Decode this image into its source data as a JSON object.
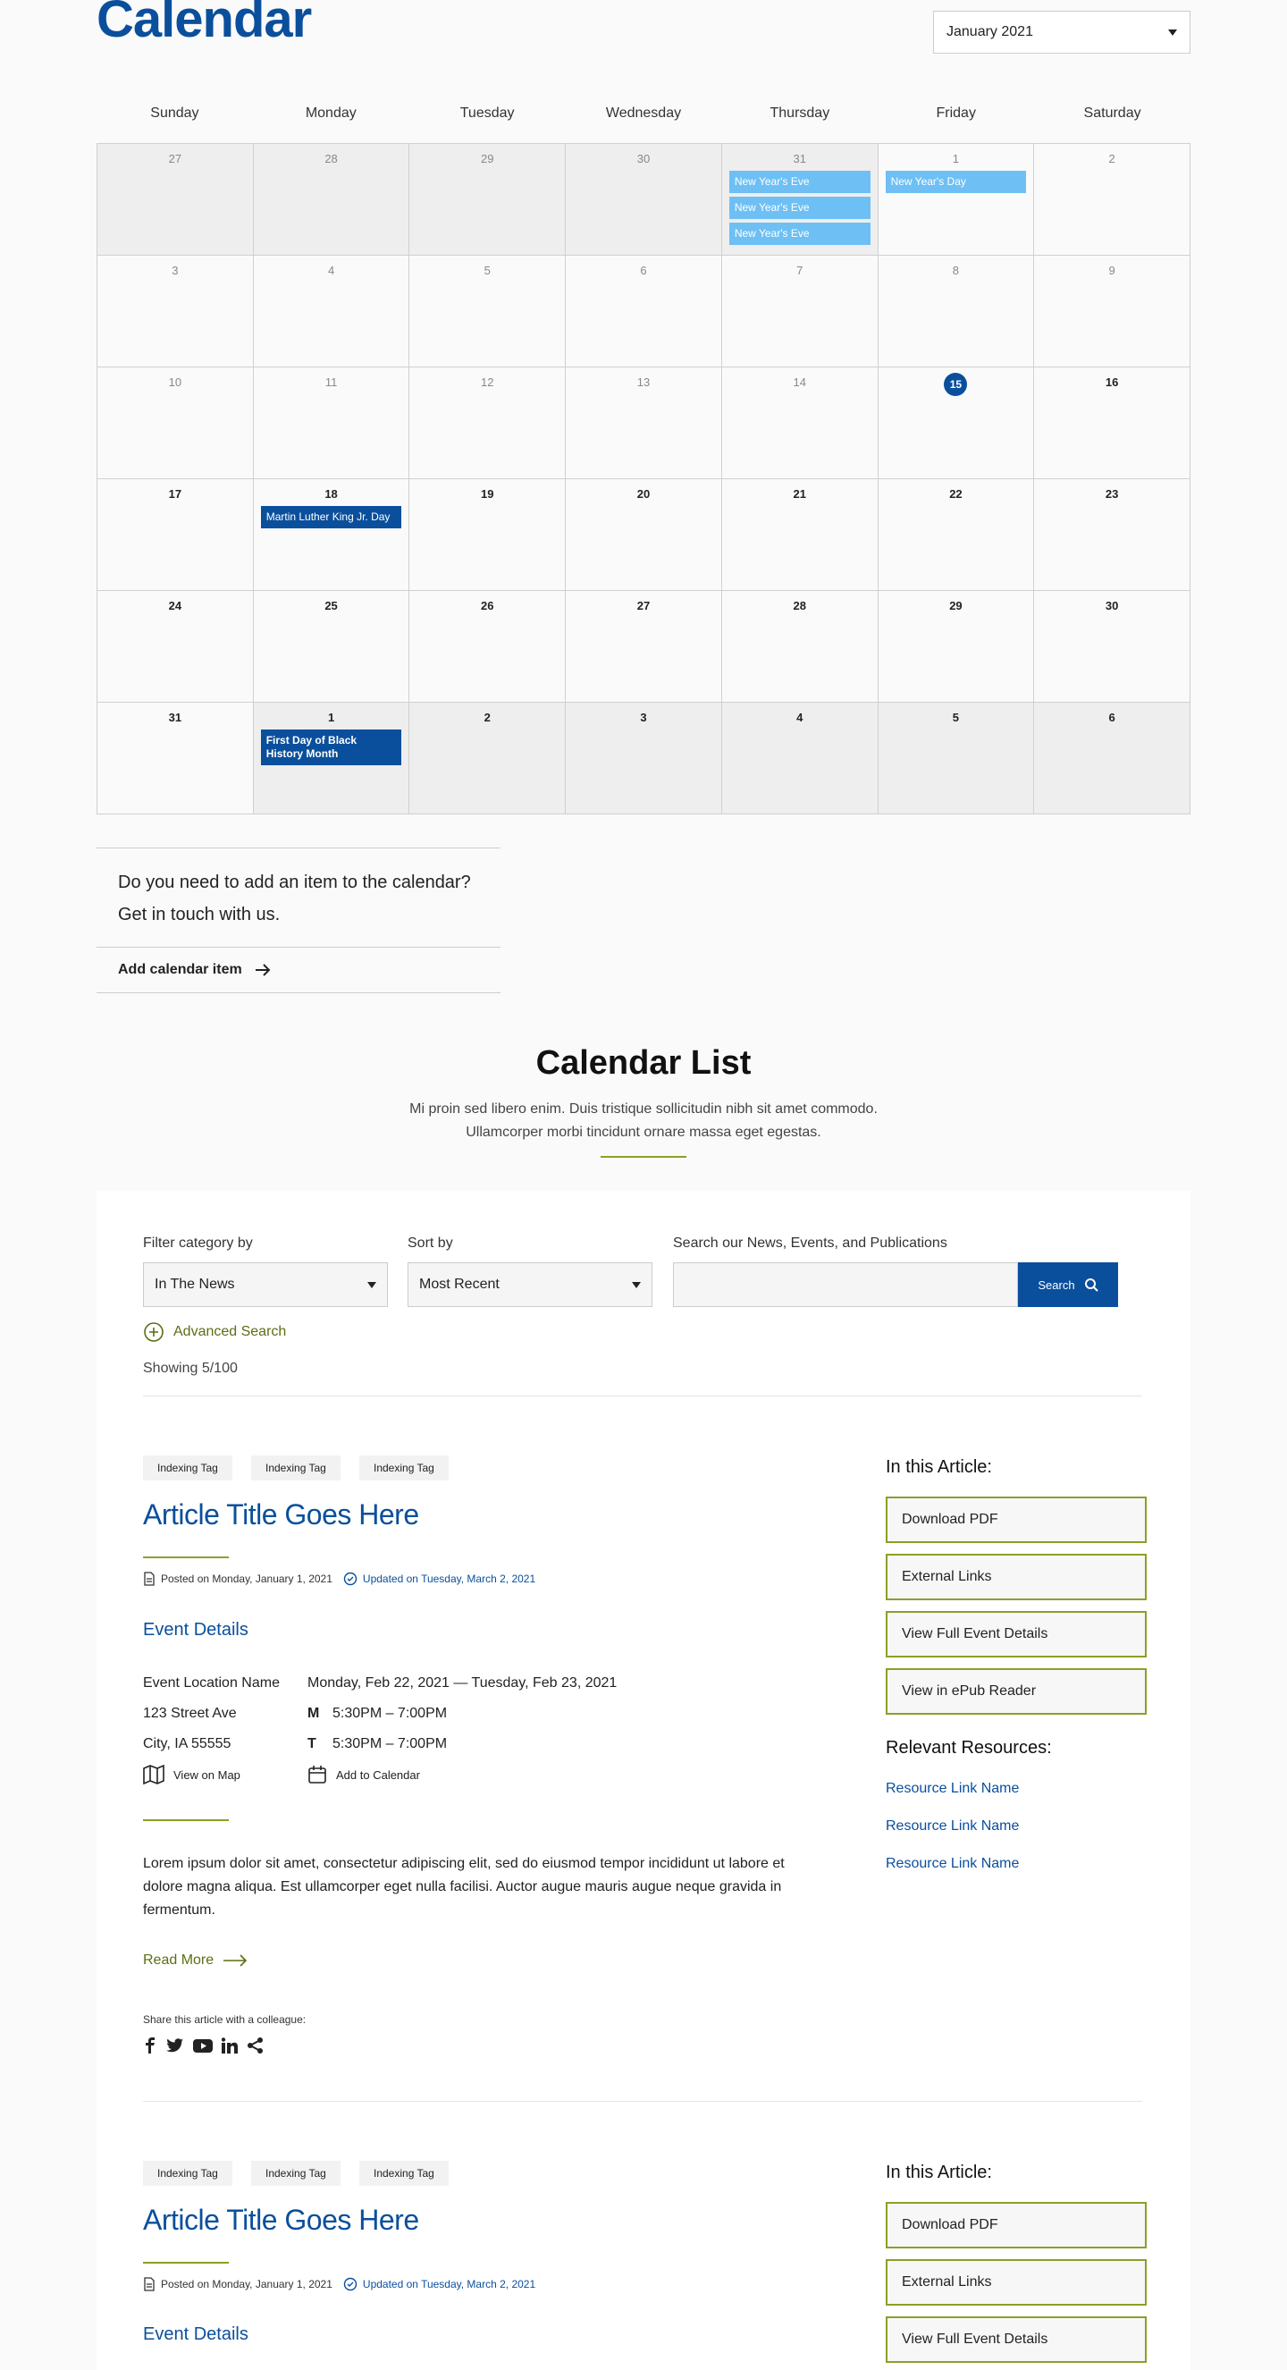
{
  "page": {
    "title": "Calendar"
  },
  "month_select": {
    "value": "January 2021"
  },
  "calendar": {
    "weekdays": [
      "Sunday",
      "Monday",
      "Tuesday",
      "Wednesday",
      "Thursday",
      "Friday",
      "Saturday"
    ],
    "weeks": [
      [
        {
          "d": "27",
          "out": true
        },
        {
          "d": "28",
          "out": true
        },
        {
          "d": "29",
          "out": true
        },
        {
          "d": "30",
          "out": true
        },
        {
          "d": "31",
          "out": true,
          "events": [
            {
              "t": "New Year's Eve",
              "style": "light"
            },
            {
              "t": "New Year's Eve",
              "style": "light"
            },
            {
              "t": "New Year's Eve",
              "style": "light"
            }
          ]
        },
        {
          "d": "1",
          "events": [
            {
              "t": "New Year's Day",
              "style": "light"
            }
          ]
        },
        {
          "d": "2"
        }
      ],
      [
        {
          "d": "3"
        },
        {
          "d": "4"
        },
        {
          "d": "5"
        },
        {
          "d": "6"
        },
        {
          "d": "7"
        },
        {
          "d": "8"
        },
        {
          "d": "9"
        }
      ],
      [
        {
          "d": "10"
        },
        {
          "d": "11"
        },
        {
          "d": "12"
        },
        {
          "d": "13"
        },
        {
          "d": "14"
        },
        {
          "d": "15",
          "today": true
        },
        {
          "d": "16",
          "bold": true
        }
      ],
      [
        {
          "d": "17",
          "bold": true
        },
        {
          "d": "18",
          "bold": true,
          "events": [
            {
              "t": "Martin Luther King Jr. Day",
              "style": "dark"
            }
          ]
        },
        {
          "d": "19",
          "bold": true
        },
        {
          "d": "20",
          "bold": true
        },
        {
          "d": "21",
          "bold": true
        },
        {
          "d": "22",
          "bold": true
        },
        {
          "d": "23",
          "bold": true
        }
      ],
      [
        {
          "d": "24",
          "bold": true
        },
        {
          "d": "25",
          "bold": true
        },
        {
          "d": "26",
          "bold": true
        },
        {
          "d": "27",
          "bold": true
        },
        {
          "d": "28",
          "bold": true
        },
        {
          "d": "29",
          "bold": true
        },
        {
          "d": "30",
          "bold": true
        }
      ],
      [
        {
          "d": "31",
          "bold": true
        },
        {
          "d": "1",
          "bold": true,
          "out": true,
          "events": [
            {
              "t": "First Day of Black History Month",
              "style": "dark",
              "bold": true
            }
          ]
        },
        {
          "d": "2",
          "bold": true,
          "out": true
        },
        {
          "d": "3",
          "bold": true,
          "out": true
        },
        {
          "d": "4",
          "bold": true,
          "out": true
        },
        {
          "d": "5",
          "bold": true,
          "out": true
        },
        {
          "d": "6",
          "bold": true,
          "out": true
        }
      ]
    ]
  },
  "add_item": {
    "question_line1": "Do you need to add an item to the calendar?",
    "question_line2": "Get in touch with us.",
    "link": "Add calendar item"
  },
  "calendar_list": {
    "title": "Calendar List",
    "sub_line1": "Mi proin sed libero enim. Duis tristique sollicitudin nibh sit amet commodo.",
    "sub_line2": "Ullamcorper morbi tincidunt ornare massa eget egestas."
  },
  "filters": {
    "category_label": "Filter category by",
    "category_value": "In The News",
    "sort_label": "Sort by",
    "sort_value": "Most Recent",
    "search_label": "Search our News, Events, and Publications",
    "search_button": "Search",
    "advanced": "Advanced Search",
    "showing": "Showing 5/100"
  },
  "articles": [
    {
      "tags": [
        "Indexing Tag",
        "Indexing Tag",
        "Indexing Tag"
      ],
      "title": "Article Title Goes Here",
      "posted": "Posted on Monday, January 1, 2021",
      "updated": "Updated on Tuesday, March 2, 2021",
      "event_heading": "Event Details",
      "location_name": "Event Location Name",
      "street": "123 Street Ave",
      "city": "City, IA 55555",
      "map_link": "View on Map",
      "date_range": "Monday, Feb 22, 2021 — Tuesday, Feb 23, 2021",
      "day1_letter": "M",
      "day1_time": "5:30PM – 7:00PM",
      "day2_letter": "T",
      "day2_time": "5:30PM – 7:00PM",
      "calendar_link": "Add to Calendar",
      "desc_line1": "Lorem ipsum dolor sit amet, consectetur adipiscing elit, sed do eiusmod tempor incididunt ut labore et",
      "desc_line2": "dolore magna aliqua. Est ullamcorper eget nulla facilisi. Auctor augue mauris augue neque gravida in",
      "desc_line3": "fermentum.",
      "read_more": "Read More",
      "share_label": "Share this article with a colleague:",
      "in_article_heading": "In this Article:",
      "in_article_links": [
        "Download PDF",
        "External Links",
        "View Full Event Details",
        "View in ePub Reader"
      ],
      "resources_heading": "Relevant Resources:",
      "resources": [
        "Resource Link Name",
        "Resource Link Name",
        "Resource Link Name"
      ]
    },
    {
      "tags": [
        "Indexing Tag",
        "Indexing Tag",
        "Indexing Tag"
      ],
      "title": "Article Title Goes Here",
      "posted": "Posted on Monday, January 1, 2021",
      "updated": "Updated on Tuesday, March 2, 2021",
      "event_heading": "Event Details",
      "in_article_heading": "In this Article:",
      "in_article_links": [
        "Download PDF",
        "External Links",
        "View Full Event Details"
      ]
    }
  ],
  "colors": {
    "brand_blue": "#0a4f9c",
    "accent_green": "#8aa028",
    "event_light": "#6ec0f4"
  }
}
